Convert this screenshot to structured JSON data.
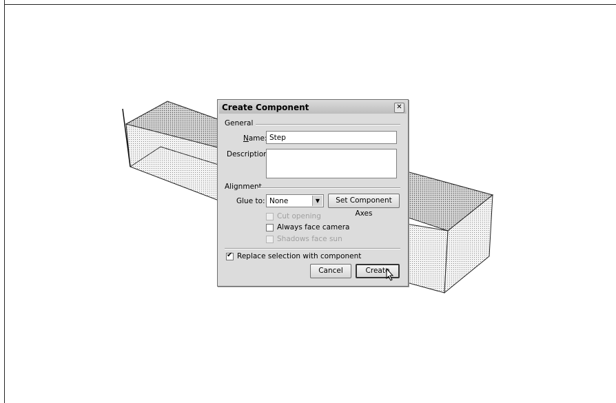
{
  "dialog": {
    "title": "Create Component",
    "close_icon": "close-icon",
    "general_label": "General",
    "name_label": "Name:",
    "name_value": "Step",
    "description_label": "Description:",
    "description_value": "",
    "alignment_label": "Alignment",
    "glue_to_label": "Glue to:",
    "glue_to_value": "None",
    "set_axes_button": "Set Component Axes",
    "cut_opening_label": "Cut opening",
    "always_face_camera_label": "Always face camera",
    "shadows_face_sun_label": "Shadows face sun",
    "replace_selection_label": "Replace selection with component",
    "replace_selection_checked": true,
    "cancel_button": "Cancel",
    "create_button": "Create"
  },
  "icons": {
    "cursor": "pointer-cursor-icon",
    "dropdown": "chevron-down-icon"
  }
}
